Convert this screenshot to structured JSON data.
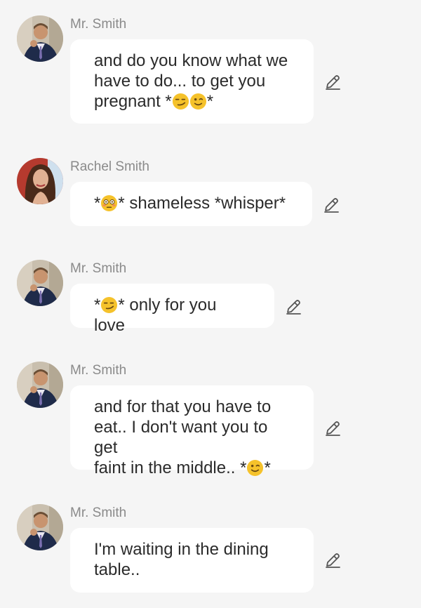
{
  "messages": [
    {
      "sender": "Mr. Smith",
      "avatar": "man-in-suit-avatar",
      "text_parts": [
        "and do you know what we have to do... to get you pregnant *",
        "smirk-emoji",
        "wink-emoji",
        "*"
      ]
    },
    {
      "sender": "Rachel Smith",
      "avatar": "woman-avatar",
      "text_parts": [
        "*",
        "flushed-emoji",
        "* shameless *whisper*"
      ]
    },
    {
      "sender": "Mr. Smith",
      "avatar": "man-in-suit-avatar",
      "text_parts": [
        "*",
        "smirk-emoji",
        "* only for you love"
      ]
    },
    {
      "sender": "Mr. Smith",
      "avatar": "man-in-suit-avatar",
      "text_parts": [
        "and for that you have to eat.. I don't want you to get faint in the middle.. *",
        "wink-emoji",
        "*"
      ]
    },
    {
      "sender": "Mr. Smith",
      "avatar": "man-in-suit-avatar",
      "text_parts": [
        "I'm waiting in the dining table.."
      ]
    }
  ],
  "m0": {
    "name": "Mr. Smith",
    "l1": "and do you know what we",
    "l2": "have to do... to get you",
    "l3a": "pregnant *",
    "l3b": "*"
  },
  "m1": {
    "name": "Rachel Smith",
    "a": "*",
    "b": "* shameless *whisper*"
  },
  "m2": {
    "name": "Mr. Smith",
    "a": "*",
    "b": "* only for you love"
  },
  "m3": {
    "name": "Mr. Smith",
    "l1": "and for that you have to",
    "l2": "eat.. I don't want you to get",
    "l3a": "faint in the middle.. *",
    "l3b": "*"
  },
  "m4": {
    "name": "Mr. Smith",
    "l1": "I'm waiting in the dining",
    "l2": "table.."
  },
  "colors": {
    "background": "#f5f5f5",
    "bubble": "#ffffff",
    "sender": "#8a8a8a",
    "text": "#2b2b2b",
    "edit_icon": "#555555"
  }
}
